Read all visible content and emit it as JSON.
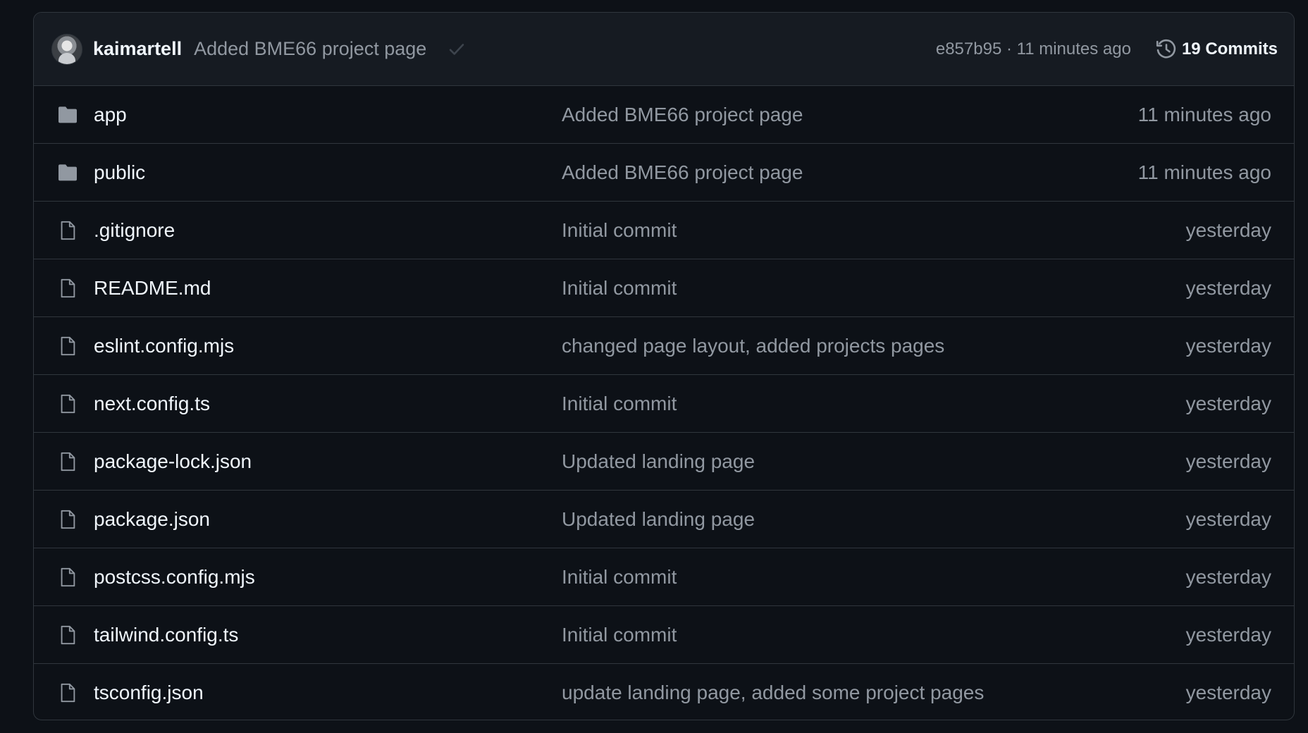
{
  "header": {
    "author": "kaimartell",
    "message": "Added BME66 project page",
    "status_icon": "check-icon",
    "meta": "e857b95 · 11 minutes ago",
    "commits_icon": "history-icon",
    "commits_label": "19 Commits"
  },
  "colors": {
    "background": "#0d1117",
    "header_background": "#161b22",
    "border": "#30363d",
    "primary_text": "#f0f6fc",
    "muted_text": "#9198a1",
    "folder_icon": "#9198a1"
  },
  "files": [
    {
      "type": "folder",
      "icon": "folder-icon",
      "name": "app",
      "commit": "Added BME66 project page",
      "date": "11 minutes ago"
    },
    {
      "type": "folder",
      "icon": "folder-icon",
      "name": "public",
      "commit": "Added BME66 project page",
      "date": "11 minutes ago"
    },
    {
      "type": "file",
      "icon": "file-icon",
      "name": ".gitignore",
      "commit": "Initial commit",
      "date": "yesterday"
    },
    {
      "type": "file",
      "icon": "file-icon",
      "name": "README.md",
      "commit": "Initial commit",
      "date": "yesterday"
    },
    {
      "type": "file",
      "icon": "file-icon",
      "name": "eslint.config.mjs",
      "commit": "changed page layout, added projects pages",
      "date": "yesterday"
    },
    {
      "type": "file",
      "icon": "file-icon",
      "name": "next.config.ts",
      "commit": "Initial commit",
      "date": "yesterday"
    },
    {
      "type": "file",
      "icon": "file-icon",
      "name": "package-lock.json",
      "commit": "Updated landing page",
      "date": "yesterday"
    },
    {
      "type": "file",
      "icon": "file-icon",
      "name": "package.json",
      "commit": "Updated landing page",
      "date": "yesterday"
    },
    {
      "type": "file",
      "icon": "file-icon",
      "name": "postcss.config.mjs",
      "commit": "Initial commit",
      "date": "yesterday"
    },
    {
      "type": "file",
      "icon": "file-icon",
      "name": "tailwind.config.ts",
      "commit": "Initial commit",
      "date": "yesterday"
    },
    {
      "type": "file",
      "icon": "file-icon",
      "name": "tsconfig.json",
      "commit": "update landing page, added some project pages",
      "date": "yesterday"
    }
  ]
}
